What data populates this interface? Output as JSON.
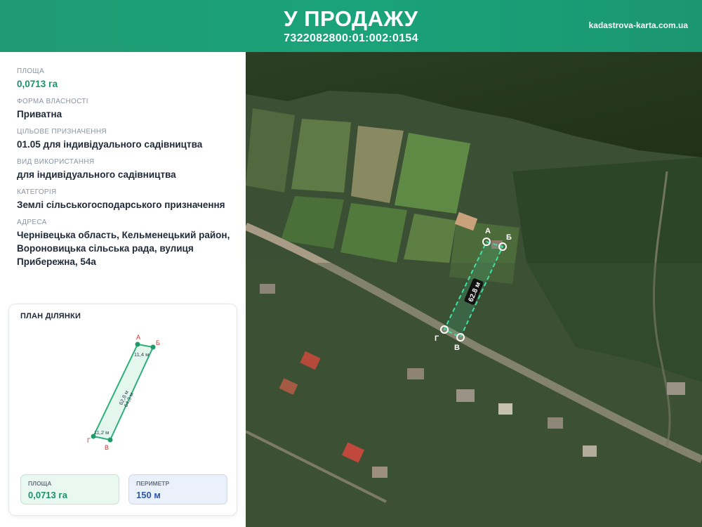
{
  "header": {
    "title": "У ПРОДАЖУ",
    "cadastral_number": "7322082800:01:002:0154",
    "site": "kadastrova-karta.com.ua"
  },
  "info": {
    "area_label": "ПЛОЩА",
    "area_value": "0,0713 га",
    "ownership_label": "ФОРМА ВЛАСНОСТІ",
    "ownership_value": "Приватна",
    "purpose_label": "ЦІЛЬОВЕ ПРИЗНАЧЕННЯ",
    "purpose_value": "01.05 для індивідуального садівництва",
    "usage_label": "ВИД ВИКОРИСТАННЯ",
    "usage_value": "для індивідуального садівництва",
    "category_label": "КАТЕГОРІЯ",
    "category_value": "Землі сільськогосподарського призначення",
    "address_label": "АДРЕСА",
    "address_value": "Чернівецька область, Кельменецький район, Вороновицька сільська рада, вулиця Прибережна, 54а"
  },
  "plan": {
    "title": "ПЛАН ДІЛЯНКИ",
    "vertices": [
      "А",
      "Б",
      "В",
      "Г"
    ],
    "edges": [
      "11,4 м",
      "62,8 м",
      "64,3 м",
      "11,2 м"
    ],
    "area_label": "ПЛОЩА",
    "area_value": "0,0713 га",
    "perimeter_label": "ПЕРИМЕТР",
    "perimeter_value": "150 м"
  },
  "map": {
    "view": "satellite",
    "vertices": [
      "А",
      "Б",
      "В",
      "Г"
    ],
    "length_label": "62.8 м",
    "parcel_color": "#3fe0a6"
  }
}
